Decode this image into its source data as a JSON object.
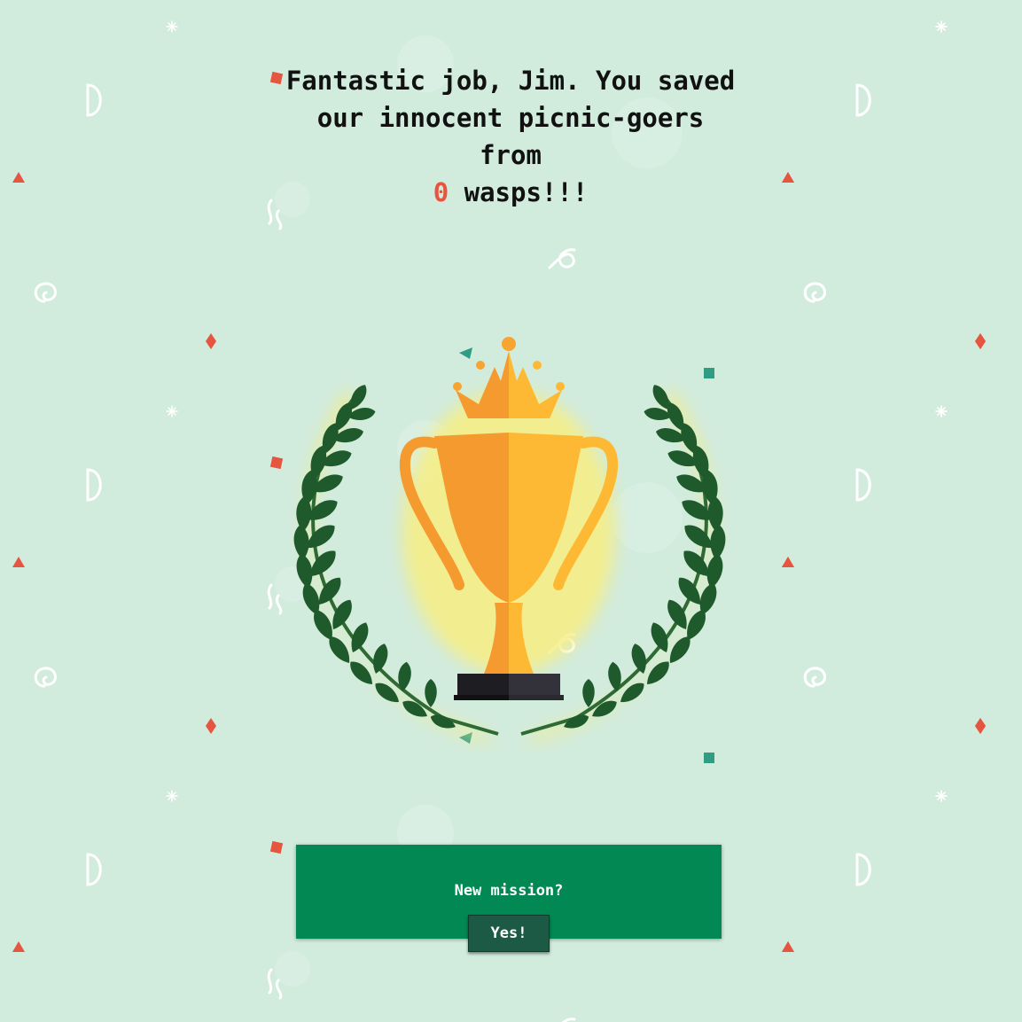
{
  "page": {
    "background_color": "#d1ebdd",
    "pattern_color": "#ffffff",
    "accent_red": "#e6553f",
    "accent_teal": "#2f9c83"
  },
  "headline": {
    "line1": "Fantastic job, Jim. You saved",
    "line2": "our innocent picnic-goers",
    "line3": "from",
    "count": "0",
    "line4_suffix": " wasps!!!"
  },
  "trophy": {
    "icon": "trophy-icon",
    "crown_icon": "crown-icon",
    "wreath_icon": "laurel-wreath-icon"
  },
  "mission": {
    "prompt": "New mission?",
    "confirm_label": "Yes!",
    "panel_color": "#018853",
    "button_color": "#1c5a45"
  }
}
